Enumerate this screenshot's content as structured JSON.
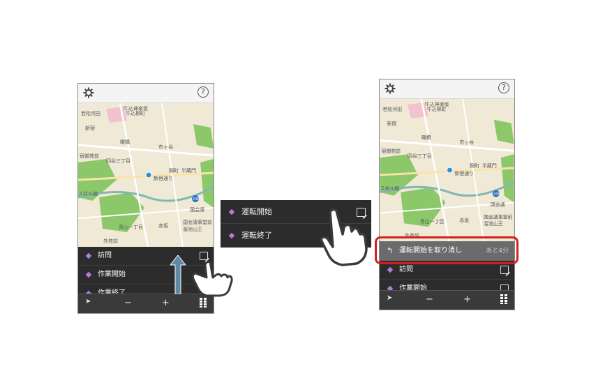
{
  "map_labels": {
    "ushigome_kagurazaka": "牛込神楽坂",
    "wakamatsu_kawada": "若松河田",
    "ushigome_yanagicho": "牛込柳町",
    "shinjuku": "新宿",
    "akebonobashi": "曙橋",
    "ichigaya": "市ヶ谷",
    "shinjuku_gyoen": "宿御苑前",
    "yotsuya_sanchome": "四谷三丁目",
    "shinjuku_dori": "新宿通り",
    "kojimachi": "麹町",
    "hanzomon": "半蔵門",
    "route_246": "246",
    "kokkai": "国会議",
    "kokkai_gijido": "国会議事堂前",
    "tameike_sanno": "溜池山王",
    "akasaka": "赤坂",
    "aoyama_itchome": "青山一丁目",
    "gaienmae": "外苑前",
    "ikeshiri": "ス井ル線"
  },
  "phone_left": {
    "help_label": "?",
    "menu_items": [
      {
        "label": "訪問",
        "has_edit": true
      },
      {
        "label": "作業開始",
        "has_edit": false
      },
      {
        "label": "作業終了",
        "has_edit": false
      }
    ],
    "toolbar": {
      "locate": "➤",
      "zoom_out": "−",
      "zoom_in": "+"
    }
  },
  "zoom_panel": {
    "items": [
      {
        "label": "運転開始"
      },
      {
        "label": "運転終了"
      }
    ]
  },
  "phone_right": {
    "help_label": "?",
    "undo_bar": {
      "label": "運転開始を取り消し",
      "time": "あと4分"
    },
    "menu_items": [
      {
        "label": "訪問"
      },
      {
        "label": "作業開始"
      }
    ],
    "toolbar": {
      "locate": "➤",
      "zoom_out": "−",
      "zoom_in": "+"
    }
  },
  "colors": {
    "accent_diamond": "#b47be0",
    "highlight_border": "#d42020",
    "arrow_fill": "#5f8aa6"
  }
}
